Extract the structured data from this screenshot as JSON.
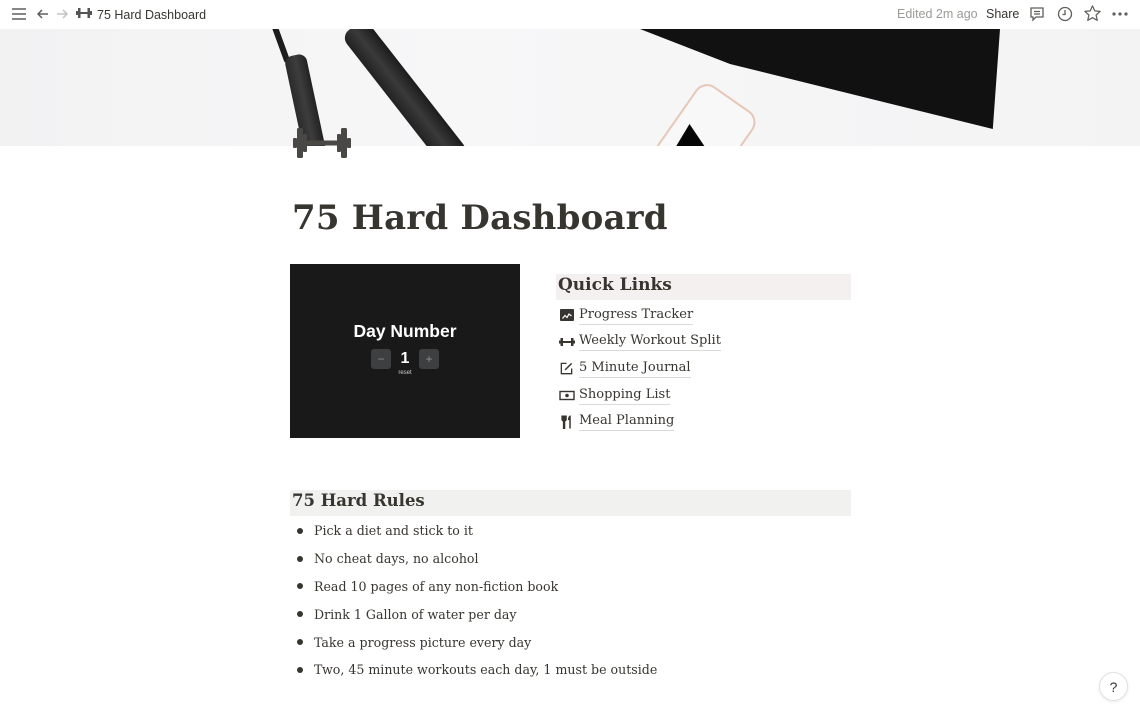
{
  "topbar": {
    "breadcrumb_title": "75 Hard Dashboard",
    "breadcrumb_icon": "dumbbell-icon",
    "edited": "Edited 2m ago",
    "share_label": "Share",
    "icons": [
      "sidebar-menu-icon",
      "back-arrow-icon",
      "forward-arrow-icon",
      "comment-icon",
      "clock-history-icon",
      "star-icon",
      "more-dots-icon"
    ]
  },
  "page": {
    "icon": "dumbbell-icon",
    "title": "75 Hard Dashboard"
  },
  "day_counter": {
    "title": "Day Number",
    "value": "1",
    "decrement_label": "−",
    "increment_label": "+",
    "reset_label": "reset"
  },
  "quick_links": {
    "heading": "Quick Links",
    "items": [
      {
        "label": "Progress Tracker",
        "icon": "chart-icon"
      },
      {
        "label": "Weekly Workout Split",
        "icon": "dumbbell-icon"
      },
      {
        "label": "5 Minute Journal",
        "icon": "edit-icon"
      },
      {
        "label": "Shopping List",
        "icon": "money-icon"
      },
      {
        "label": "Meal Planning",
        "icon": "utensils-icon"
      }
    ]
  },
  "rules": {
    "heading": "75 Hard Rules",
    "items": [
      "Pick a diet and stick to it",
      "No cheat days, no alcohol",
      "Read 10 pages of any non-fiction book",
      "Drink 1 Gallon of water per day",
      "Take a progress picture every day",
      "Two, 45 minute workouts each day, 1 must be outside"
    ]
  },
  "help": {
    "label": "?"
  }
}
